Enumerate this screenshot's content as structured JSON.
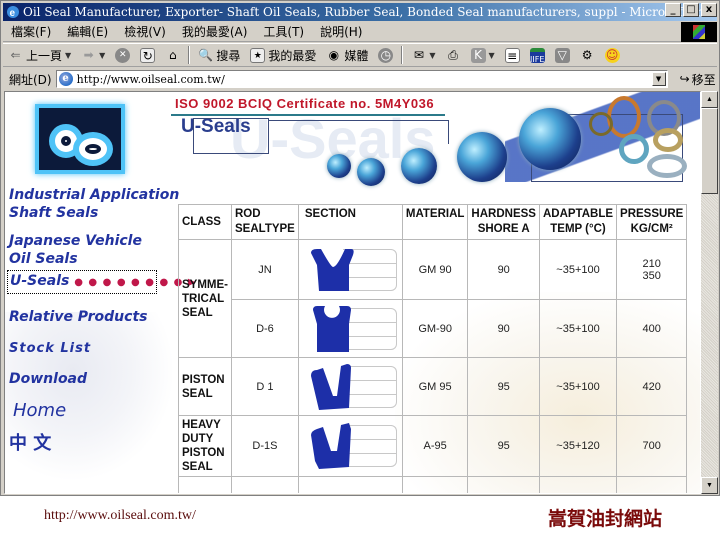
{
  "window": {
    "title": "Oil Seal Manufacturer, Exporter- Shaft Oil Seals, Rubber Seal, Bonded Seal manufacturers, suppl - Microsoft Internet Explorer",
    "controls": {
      "minimize": "_",
      "maximize": "□",
      "close": "x"
    }
  },
  "menubar": {
    "items": [
      {
        "label": "檔案(F)"
      },
      {
        "label": "編輯(E)"
      },
      {
        "label": "檢視(V)"
      },
      {
        "label": "我的最愛(A)"
      },
      {
        "label": "工具(T)"
      },
      {
        "label": "說明(H)"
      }
    ]
  },
  "toolbar": {
    "back_label": "上一頁",
    "search_label": "搜尋",
    "favorites_label": "我的最愛",
    "media_label": "媒體"
  },
  "addressbar": {
    "label": "網址(D)",
    "url": "http://www.oilseal.com.tw/",
    "go_label": "移至"
  },
  "page": {
    "certificate": "ISO 9002 BCIQ Certificate no. 5M4Y036",
    "section_title": "U-Seals",
    "section_watermark": "U-Seals",
    "nav": [
      {
        "line1": "Industrial Application",
        "line2": "Shaft Seals"
      },
      {
        "line1": "Japanese Vehicle",
        "line2": "Oil Seals"
      },
      {
        "line1": "U-Seals",
        "line2": "",
        "dots": "● ● ● ● ● ● ● ● ▶",
        "active": true
      },
      {
        "line1": "Relative Products",
        "line2": ""
      },
      {
        "line1": "Stock List",
        "line2": ""
      },
      {
        "line1": "Download",
        "line2": ""
      },
      {
        "line1": "Home",
        "line2": ""
      },
      {
        "line1": "中 文",
        "line2": ""
      }
    ],
    "table": {
      "headers": {
        "class": "CLASS",
        "rod_seal_type_1": "ROD",
        "rod_seal_type_2": "SEALTYPE",
        "section": "SECTION",
        "material": "MATERIAL",
        "hardness_1": "HARDNESS",
        "hardness_2": "SHORE A",
        "temp_1": "ADAPTABLE",
        "temp_2": "TEMP (°C)",
        "pressure_1": "PRESSURE",
        "pressure_2": "KG/CM²"
      },
      "classes": {
        "symmetrical": "SYMME-TRICAL SEAL",
        "piston": "PISTON SEAL",
        "heavy_duty": "HEAVY DUTY PISTON SEAL"
      },
      "rows": [
        {
          "type": "JN",
          "section_shape": "u-cup",
          "material": "GM 90",
          "hardness": "90",
          "temp": "~35+100",
          "pressure_1": "210",
          "pressure_2": "350"
        },
        {
          "type": "D-6",
          "section_shape": "u-cup-round",
          "material": "GM-90",
          "hardness": "90",
          "temp": "~35+100",
          "pressure_1": "400",
          "pressure_2": ""
        },
        {
          "type": "D 1",
          "section_shape": "v-lip",
          "material": "GM 95",
          "hardness": "95",
          "temp": "~35+100",
          "pressure_1": "420",
          "pressure_2": ""
        },
        {
          "type": "D-1S",
          "section_shape": "v-lip-heavy",
          "material": "A-95",
          "hardness": "95",
          "temp": "~35+120",
          "pressure_1": "700",
          "pressure_2": ""
        }
      ]
    }
  },
  "scrollbar": {
    "position_fraction": 0.0
  },
  "caption": {
    "url": "http://www.oilseal.com.tw/",
    "site_name": "嵩賀油封網站"
  }
}
